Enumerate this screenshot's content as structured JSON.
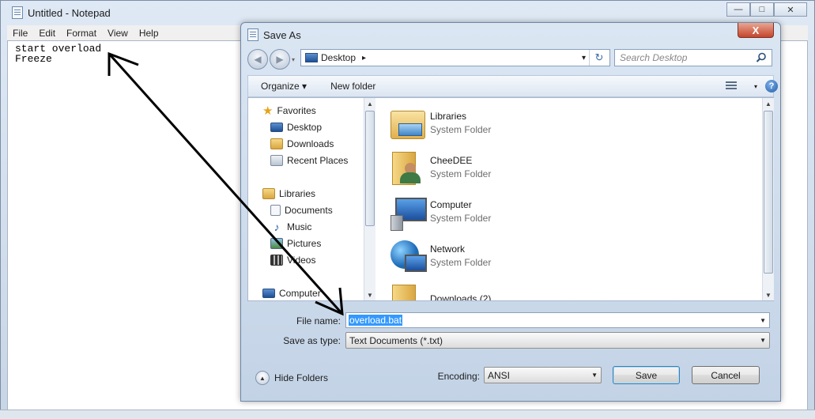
{
  "notepad": {
    "title": "Untitled - Notepad",
    "menu": [
      "File",
      "Edit",
      "Format",
      "View",
      "Help"
    ],
    "content": "start overload\nFreeze",
    "controls": {
      "minimize": "—",
      "maximize": "□",
      "close": "✕"
    }
  },
  "dialog": {
    "title": "Save As",
    "close_glyph": "X",
    "nav": {
      "back": "◀",
      "forward": "▶"
    },
    "address": {
      "location": "Desktop",
      "sep": "▸",
      "dropdown": "▾",
      "refresh": "↻"
    },
    "search": {
      "placeholder": "Search Desktop"
    },
    "toolbar": {
      "organize": "Organize ▾",
      "new_folder": "New folder",
      "help": "?"
    },
    "tree": {
      "favorites_label": "Favorites",
      "favorites": [
        "Desktop",
        "Downloads",
        "Recent Places"
      ],
      "libraries_label": "Libraries",
      "libraries": [
        "Documents",
        "Music",
        "Pictures",
        "Videos"
      ],
      "computer_label": "Computer"
    },
    "files": [
      {
        "name": "Libraries",
        "type": "System Folder"
      },
      {
        "name": "CheeDEE",
        "type": "System Folder"
      },
      {
        "name": "Computer",
        "type": "System Folder"
      },
      {
        "name": "Network",
        "type": "System Folder"
      },
      {
        "name": "Downloads (2)",
        "type": ""
      }
    ],
    "form": {
      "filename_label": "File name:",
      "filename_value": "overload.bat",
      "savetype_label": "Save as type:",
      "savetype_value": "Text Documents (*.txt)",
      "encoding_label": "Encoding:",
      "encoding_value": "ANSI"
    },
    "buttons": {
      "hide_folders": "Hide Folders",
      "save": "Save",
      "cancel": "Cancel"
    }
  },
  "colors": {
    "accent": "#3c7fb1",
    "selection": "#3399ff",
    "close": "#c5452b"
  }
}
